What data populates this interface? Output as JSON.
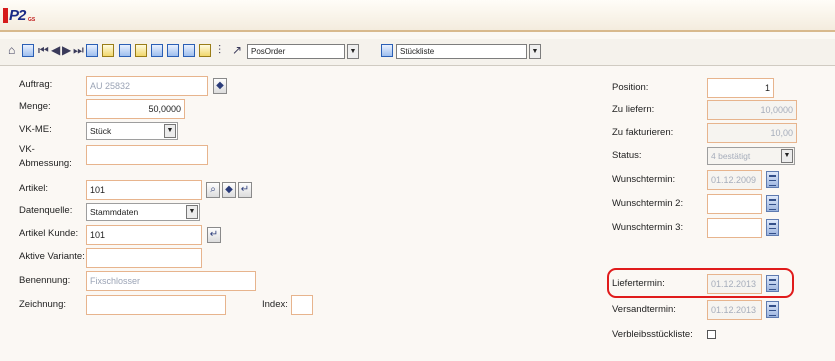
{
  "app": {
    "logo_text": "P2",
    "logo_sub": "GS"
  },
  "toolbar": {
    "icons": [
      "home-icon",
      "list-icon",
      "first-icon",
      "prev-icon",
      "next-icon",
      "last-icon",
      "grid-icon",
      "edit-icon",
      "table-icon",
      "table-edit-icon",
      "table-add-icon",
      "print-icon",
      "copy-icon",
      "paste-icon",
      "filter-icon",
      "cursor-icon"
    ],
    "view_select": "PosOrder",
    "list_select": "Stückliste"
  },
  "left": {
    "auftrag": {
      "label": "Auftrag:",
      "value": "AU 25832"
    },
    "menge": {
      "label": "Menge:",
      "value": "50,0000"
    },
    "vkme": {
      "label": "VK-ME:",
      "value": "Stück"
    },
    "abmessung": {
      "label1": "VK-",
      "label2": "Abmessung:",
      "value": ""
    },
    "artikel": {
      "label": "Artikel:",
      "value": "101"
    },
    "datenquelle": {
      "label": "Datenquelle:",
      "value": "Stammdaten"
    },
    "artikel_kunde": {
      "label": "Artikel Kunde:",
      "value": "101"
    },
    "aktive_variante": {
      "label": "Aktive Variante:",
      "value": ""
    },
    "benennung": {
      "label": "Benennung:",
      "value": "Fixschlosser"
    },
    "zeichnung": {
      "label": "Zeichnung:",
      "value": ""
    },
    "index": {
      "label": "Index:",
      "value": ""
    }
  },
  "right": {
    "position": {
      "label": "Position:",
      "value": "1"
    },
    "zu_liefern": {
      "label": "Zu liefern:",
      "value": "10,0000"
    },
    "zu_fakturieren": {
      "label": "Zu fakturieren:",
      "value": "10,00"
    },
    "status": {
      "label": "Status:",
      "value": "4 bestätigt"
    },
    "wunschtermin": {
      "label": "Wunschtermin:",
      "value": "01.12.2009"
    },
    "wunschtermin2": {
      "label": "Wunschtermin 2:",
      "value": ""
    },
    "wunschtermin3": {
      "label": "Wunschtermin 3:",
      "value": ""
    },
    "liefertermin": {
      "label": "Liefertermin:",
      "value": "01.12.2013"
    },
    "versandtermin": {
      "label": "Versandtermin:",
      "value": "01.12.2013"
    },
    "verbleib": {
      "label": "Verbleibsstückliste:"
    }
  },
  "colors": {
    "highlight": "#e01b1b",
    "field_border": "#e7b48d",
    "title_border": "#d8b98d"
  }
}
